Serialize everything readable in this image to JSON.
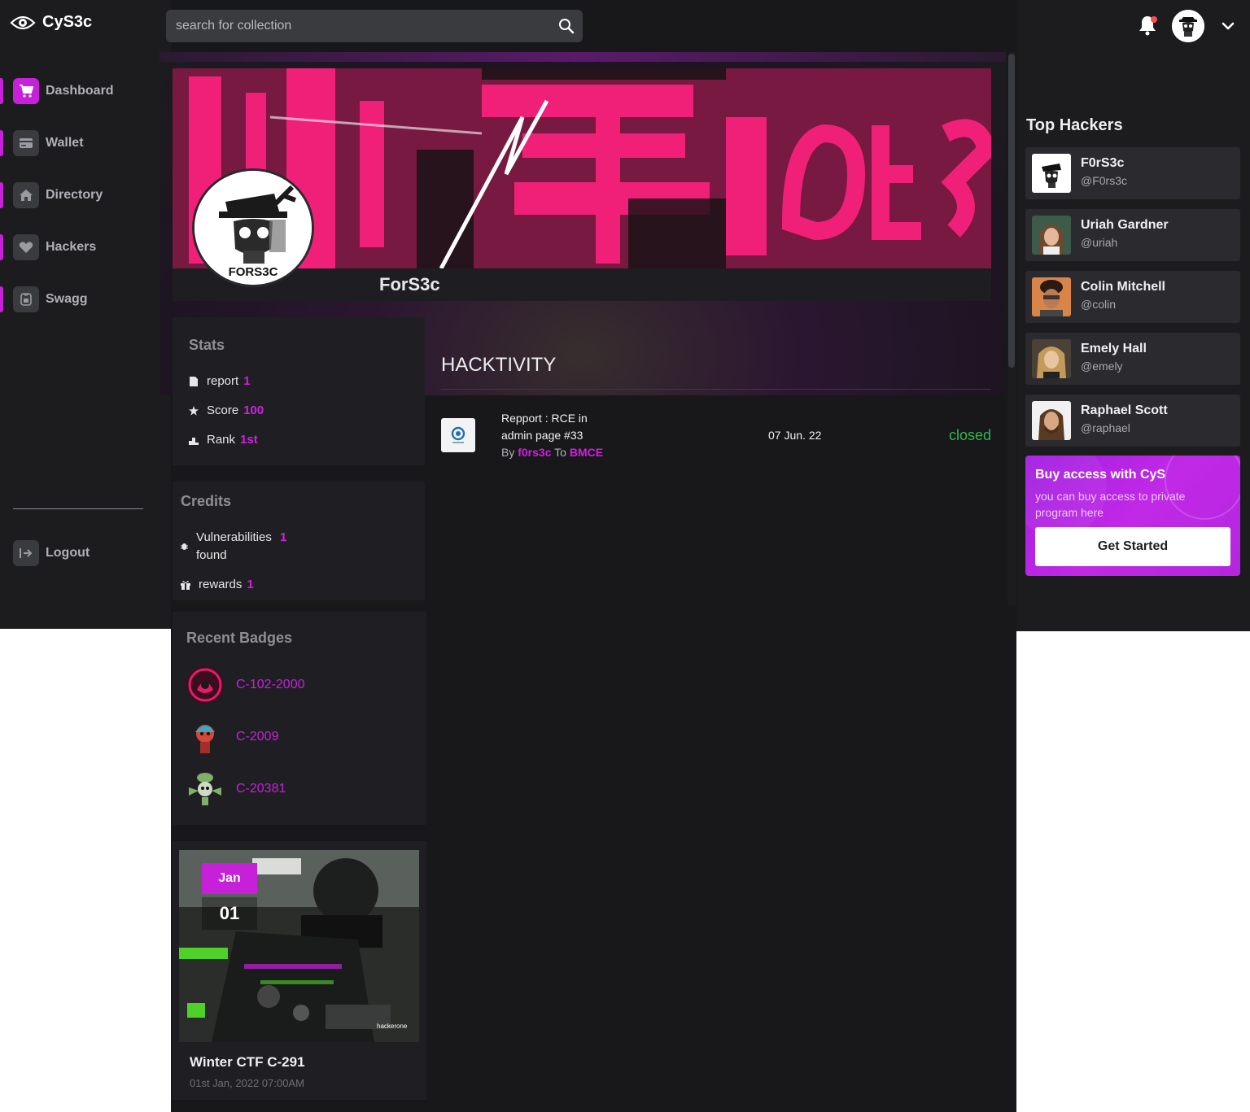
{
  "app": {
    "name": "CyS3c"
  },
  "search": {
    "placeholder": "search for collection"
  },
  "sidebar": {
    "items": [
      {
        "label": "Dashboard",
        "icon": "cart-icon",
        "active": true
      },
      {
        "label": "Wallet",
        "icon": "wallet-icon",
        "active": false
      },
      {
        "label": "Directory",
        "icon": "home-icon",
        "active": false
      },
      {
        "label": "Hackers",
        "icon": "heart-icon",
        "active": false
      },
      {
        "label": "Swagg",
        "icon": "shirt-icon",
        "active": false
      }
    ],
    "logout": "Logout"
  },
  "profile": {
    "name": "ForS3c",
    "avatar_caption": "FORS3C"
  },
  "stats": {
    "title": "Stats",
    "rows": [
      {
        "label": "report",
        "value": "1",
        "icon": "file-icon"
      },
      {
        "label": "Score",
        "value": "100",
        "icon": "star-icon"
      },
      {
        "label": "Rank",
        "value": "1st",
        "icon": "podium-icon"
      }
    ]
  },
  "credits": {
    "title": "Credits",
    "vulns_label_1": "Vulnerabilities",
    "vulns_label_2": "found",
    "vulns_value": "1",
    "rewards_label": "rewards",
    "rewards_value": "1"
  },
  "badges": {
    "title": "Recent Badges",
    "items": [
      {
        "name": "C-102-2000"
      },
      {
        "name": "C-2009"
      },
      {
        "name": "C-20381"
      }
    ]
  },
  "event": {
    "month": "Jan",
    "day": "01",
    "title": "Winter CTF C-291",
    "date": "01st Jan, 2022 07:00AM",
    "image_watermark": "hackerone"
  },
  "hacktivity": {
    "title": "HACKTIVITY",
    "items": [
      {
        "report_line1": "Repport : RCE in",
        "report_line2": "admin page #33",
        "by_label": "By",
        "author": "f0rs3c",
        "to_label": "To",
        "program": "BMCE",
        "date": "07 Jun. 22",
        "status": "closed"
      }
    ]
  },
  "top_hackers": {
    "title": "Top Hackers",
    "items": [
      {
        "name": "F0rS3c",
        "handle": "@F0rs3c"
      },
      {
        "name": "Uriah Gardner",
        "handle": "@uriah"
      },
      {
        "name": "Colin Mitchell",
        "handle": "@colin"
      },
      {
        "name": "Emely Hall",
        "handle": "@emely"
      },
      {
        "name": "Raphael Scott",
        "handle": "@raphael"
      }
    ]
  },
  "promo": {
    "title": "Buy access with CyS",
    "text": "you can buy access to private program here",
    "button": "Get Started"
  },
  "colors": {
    "accent": "#c620d8",
    "status_closed": "#2fb84f",
    "background": "#1c1c1f",
    "card": "#1f1f23"
  }
}
